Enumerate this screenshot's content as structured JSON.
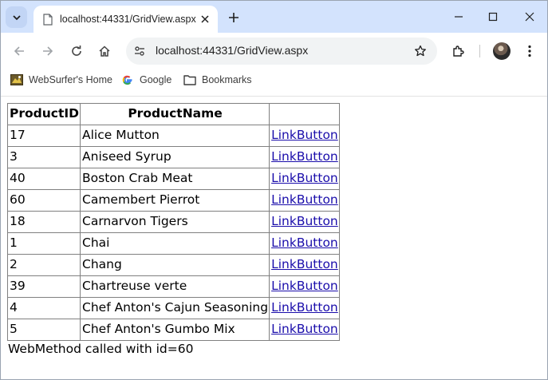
{
  "browser": {
    "tab": {
      "title": "localhost:44331/GridView.aspx",
      "icon": "page-icon"
    },
    "address": {
      "url": "localhost:44331/GridView.aspx"
    },
    "bookmarks": [
      {
        "label": "WebSurfer's Home",
        "icon": "websurfer-favicon"
      },
      {
        "label": "Google",
        "icon": "google-g-icon"
      },
      {
        "label": "Bookmarks",
        "icon": "folder-icon"
      }
    ]
  },
  "grid": {
    "headers": {
      "id": "ProductID",
      "name": "ProductName",
      "action": ""
    },
    "rows": [
      {
        "id": "17",
        "name": "Alice Mutton",
        "link": "LinkButton"
      },
      {
        "id": "3",
        "name": "Aniseed Syrup",
        "link": "LinkButton"
      },
      {
        "id": "40",
        "name": "Boston Crab Meat",
        "link": "LinkButton"
      },
      {
        "id": "60",
        "name": "Camembert Pierrot",
        "link": "LinkButton"
      },
      {
        "id": "18",
        "name": "Carnarvon Tigers",
        "link": "LinkButton"
      },
      {
        "id": "1",
        "name": "Chai",
        "link": "LinkButton"
      },
      {
        "id": "2",
        "name": "Chang",
        "link": "LinkButton"
      },
      {
        "id": "39",
        "name": "Chartreuse verte",
        "link": "LinkButton"
      },
      {
        "id": "4",
        "name": "Chef Anton's Cajun Seasoning",
        "link": "LinkButton"
      },
      {
        "id": "5",
        "name": "Chef Anton's Gumbo Mix",
        "link": "LinkButton"
      }
    ]
  },
  "status_message": "WebMethod called with id=60",
  "colors": {
    "tabstrip": "#d3e3fd",
    "link": "#1a0dab",
    "grid_border": "#808080"
  }
}
